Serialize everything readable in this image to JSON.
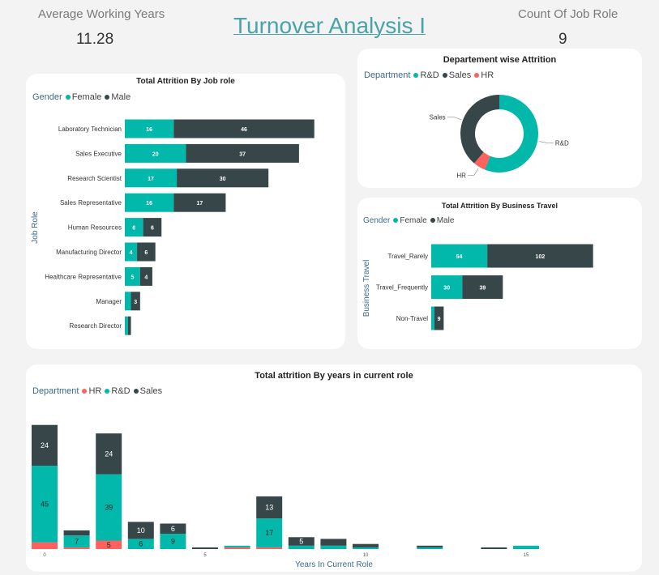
{
  "header": {
    "title": "Turnover Analysis I",
    "kpi_left": {
      "label": "Average Working Years",
      "value": "11.28"
    },
    "kpi_right": {
      "label": "Count Of Job Role",
      "value": "9"
    }
  },
  "colors": {
    "female": "#01b8aa",
    "male": "#374649",
    "hr": "#fd625e",
    "rd": "#01b8aa",
    "sales": "#374649"
  },
  "chart_data": [
    {
      "type": "bar",
      "orientation": "horizontal",
      "stacked": true,
      "title": "Total Attrition By Job role",
      "ylabel": "Job Role",
      "legend_title": "Gender",
      "categories": [
        "Laboratory Technician",
        "Sales Executive",
        "Research Scientist",
        "Sales Representative",
        "Human Resources",
        "Manufacturing Director",
        "Healthcare Representative",
        "Manager",
        "Research Director"
      ],
      "series": [
        {
          "name": "Female",
          "values": [
            16,
            20,
            17,
            16,
            6,
            4,
            5,
            2,
            1
          ]
        },
        {
          "name": "Male",
          "values": [
            46,
            37,
            30,
            17,
            6,
            6,
            4,
            3,
            1
          ]
        }
      ]
    },
    {
      "type": "pie",
      "donut": true,
      "title": "Departement wise Attrition",
      "legend_title": "Department",
      "legend_order": [
        "R&D",
        "Sales",
        "HR"
      ],
      "slices": [
        {
          "label": "R&D",
          "value": 133
        },
        {
          "label": "HR",
          "value": 12
        },
        {
          "label": "Sales",
          "value": 92
        }
      ]
    },
    {
      "type": "bar",
      "orientation": "horizontal",
      "stacked": true,
      "title": "Total Attrition By Business Travel",
      "ylabel": "Business Travel",
      "legend_title": "Gender",
      "categories": [
        "Travel_Rarely",
        "Travel_Frequently",
        "Non-Travel"
      ],
      "series": [
        {
          "name": "Female",
          "values": [
            54,
            30,
            3
          ]
        },
        {
          "name": "Male",
          "values": [
            102,
            39,
            9
          ]
        }
      ]
    },
    {
      "type": "bar",
      "stacked": true,
      "title": "Total attrition By years in current role",
      "xlabel": "Years In Current Role",
      "legend_title": "Department",
      "x": [
        0,
        1,
        2,
        3,
        4,
        5,
        6,
        7,
        8,
        9,
        10,
        11,
        12,
        13,
        14,
        15
      ],
      "xticks": [
        0,
        5,
        10,
        15
      ],
      "series": [
        {
          "name": "HR",
          "values": [
            4,
            1,
            5,
            0,
            0,
            0,
            1,
            1,
            0,
            0,
            0,
            0,
            0,
            0,
            0,
            0
          ]
        },
        {
          "name": "R&D",
          "values": [
            45,
            7,
            39,
            6,
            9,
            0,
            1,
            17,
            2,
            2,
            1,
            0,
            1,
            0,
            0,
            2
          ]
        },
        {
          "name": "Sales",
          "values": [
            24,
            3,
            24,
            10,
            6,
            1,
            0,
            13,
            5,
            4,
            2,
            0,
            1,
            0,
            1,
            0
          ]
        }
      ]
    }
  ]
}
